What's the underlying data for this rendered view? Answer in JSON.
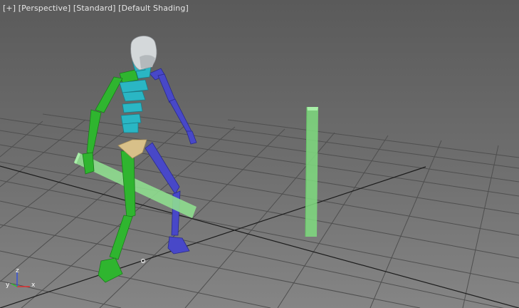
{
  "viewport": {
    "menu": {
      "plus": "[+]",
      "view": "[Perspective]",
      "visual_style": "[Standard]",
      "shading": "[Default Shading]"
    },
    "axis_tripod": {
      "x": "x",
      "y": "y",
      "z": "z"
    },
    "colors": {
      "background": "#6f6f6f",
      "grid": "#4e4e4e",
      "grid_axis": "#1a1a1a",
      "biped_left": "#2fb52f",
      "biped_right": "#4848c8",
      "biped_spine": "#2ab6c4",
      "head": "#d0d4d6",
      "pelvis": "#d8c089",
      "props": "#7fdc7f",
      "axis_x": "#e03030",
      "axis_y": "#30c030",
      "axis_z": "#3050e0"
    }
  }
}
